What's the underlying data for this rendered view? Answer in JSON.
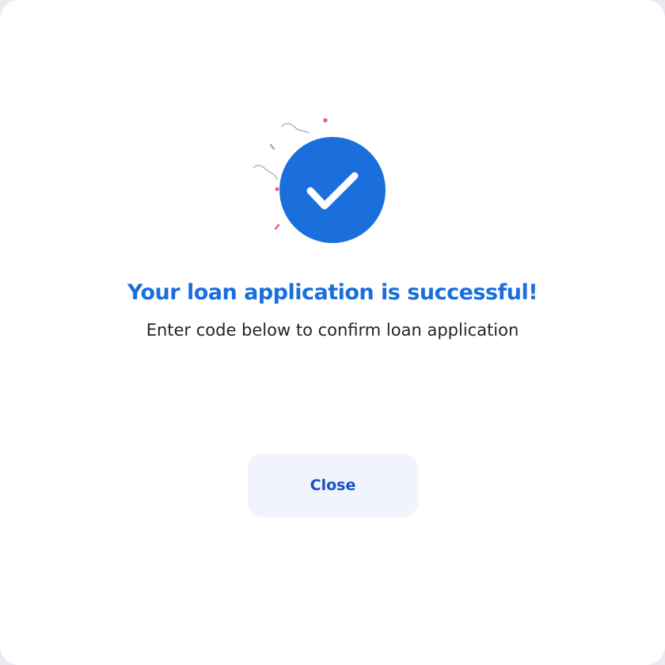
{
  "dialog": {
    "title": "Your loan application is successful!",
    "subtitle": "Enter code below to confirm loan application",
    "close_label": "Close",
    "success_icon": "check-circle-icon"
  },
  "colors": {
    "accent": "#1a6fdc",
    "button_bg": "#f1f4fb",
    "button_text": "#1650c8",
    "confetti_pink": "#f0557a",
    "confetti_gray": "#a9adb5"
  }
}
